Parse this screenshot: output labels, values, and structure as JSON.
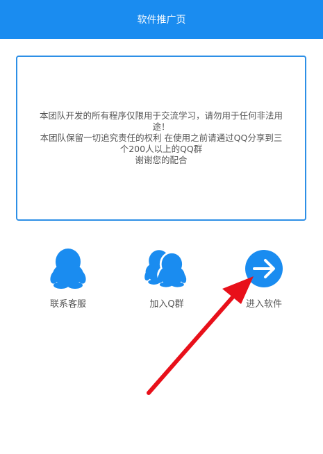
{
  "header": {
    "title": "软件推广页"
  },
  "notice": {
    "line1": "本团队开发的所有程序仅限用于交流学习，请勿用于任何非法用",
    "line2": "途！",
    "line3": "本团队保留一切追究责任的权利 在使用之前请通过QQ分享到三",
    "line4": "个200人以上的QQ群",
    "line5": "谢谢您的配合"
  },
  "actions": [
    {
      "label": "联系客服",
      "icon": "qq-penguin-icon"
    },
    {
      "label": "加入Q群",
      "icon": "qq-group-icon"
    },
    {
      "label": "进入软件",
      "icon": "arrow-right-circle-icon"
    }
  ],
  "colors": {
    "header_bg": "#1a8cf0",
    "accent": "#1a8cf0",
    "annotation_arrow": "#e8101a"
  }
}
